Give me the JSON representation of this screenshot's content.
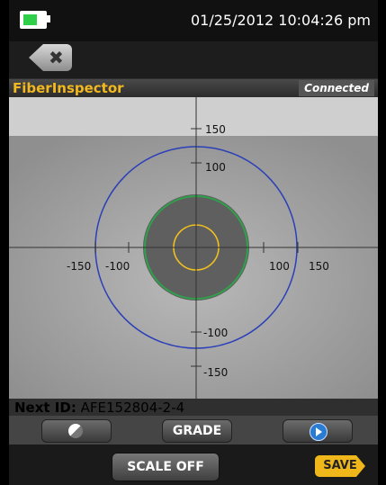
{
  "status_bar": {
    "datetime": "01/25/2012 10:04:26 pm",
    "battery_level": 0.7,
    "battery_icon": "battery-icon"
  },
  "back_button": {
    "glyph": "✖",
    "icon": "close-icon"
  },
  "title_bar": {
    "app_title": "FiberInspector",
    "status": "Connected"
  },
  "scope": {
    "x_tick_labels": [
      "-150",
      "-100",
      "100",
      "150"
    ],
    "y_tick_labels": [
      "150",
      "100",
      "-100",
      "-150"
    ],
    "colors": {
      "outer_ring": "#2a3fb8",
      "cladding_ring": "#2ea14a",
      "core_ring": "#f0c020",
      "fiber": "#5f5f5f"
    }
  },
  "next_id": {
    "label": "Next ID:",
    "value": "AFE152804-2-4"
  },
  "toolbar": {
    "contrast_icon": "contrast-icon",
    "grade_label": "GRADE",
    "play_icon": "play-icon"
  },
  "bottom_bar": {
    "scale_label": "SCALE OFF",
    "save_label": "SAVE"
  }
}
